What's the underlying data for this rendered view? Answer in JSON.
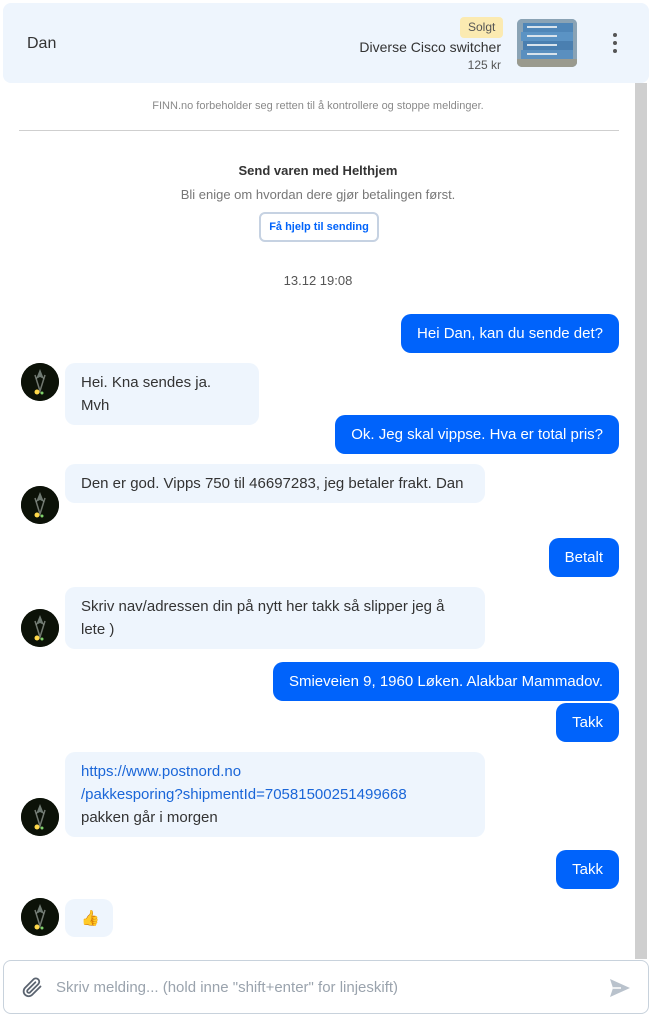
{
  "header": {
    "contact_name": "Dan",
    "status_badge": "Solgt",
    "item_title": "Diverse Cisco switcher",
    "item_price": "125 kr"
  },
  "notice": {
    "text": "FINN.no forbeholder seg retten til å kontrollere og stoppe meldinger."
  },
  "shipping": {
    "title": "Send varen med Helthjem",
    "subtitle": "Bli enige om hvordan dere gjør betalingen først.",
    "help_button": "Få hjelp til sending"
  },
  "timestamp": "13.12 19:08",
  "messages": [
    {
      "direction": "out",
      "text": "Hei Dan, kan du sende det?"
    },
    {
      "direction": "in",
      "text": "Hei. Kna sendes ja. Mvh"
    },
    {
      "direction": "out",
      "text": "Ok. Jeg skal vippse. Hva er total pris?"
    },
    {
      "direction": "in",
      "text": "Den er god. Vipps 750 til 46697283, jeg betaler frakt. Dan"
    },
    {
      "direction": "out",
      "text": "Betalt"
    },
    {
      "direction": "in",
      "text": "Skriv nav/adressen din på nytt her takk så slipper jeg å lete )"
    },
    {
      "direction": "out",
      "text": "Smieveien 9, 1960 Løken. Alakbar Mammadov."
    },
    {
      "direction": "out",
      "text": "Takk"
    },
    {
      "direction": "in",
      "link_line1": "https://www.postnord.no",
      "link_line2": "/pakkesporing?shipmentId=70581500251499668",
      "text": "pakken går i morgen"
    },
    {
      "direction": "out",
      "text": "Takk"
    },
    {
      "direction": "in",
      "text": "👍"
    }
  ],
  "composer": {
    "placeholder": "Skriv melding... (hold inne \"shift+enter\" for linjeskift)",
    "value": ""
  },
  "icons": {
    "attach": "paperclip-icon",
    "send": "send-icon",
    "menu": "more-vertical-icon"
  },
  "colors": {
    "outgoing_bubble": "#0063fb",
    "incoming_bubble": "#eef5fd",
    "header_bg": "#eef5fd",
    "sold_badge": "#fbeab1",
    "link": "#1a66d8"
  }
}
